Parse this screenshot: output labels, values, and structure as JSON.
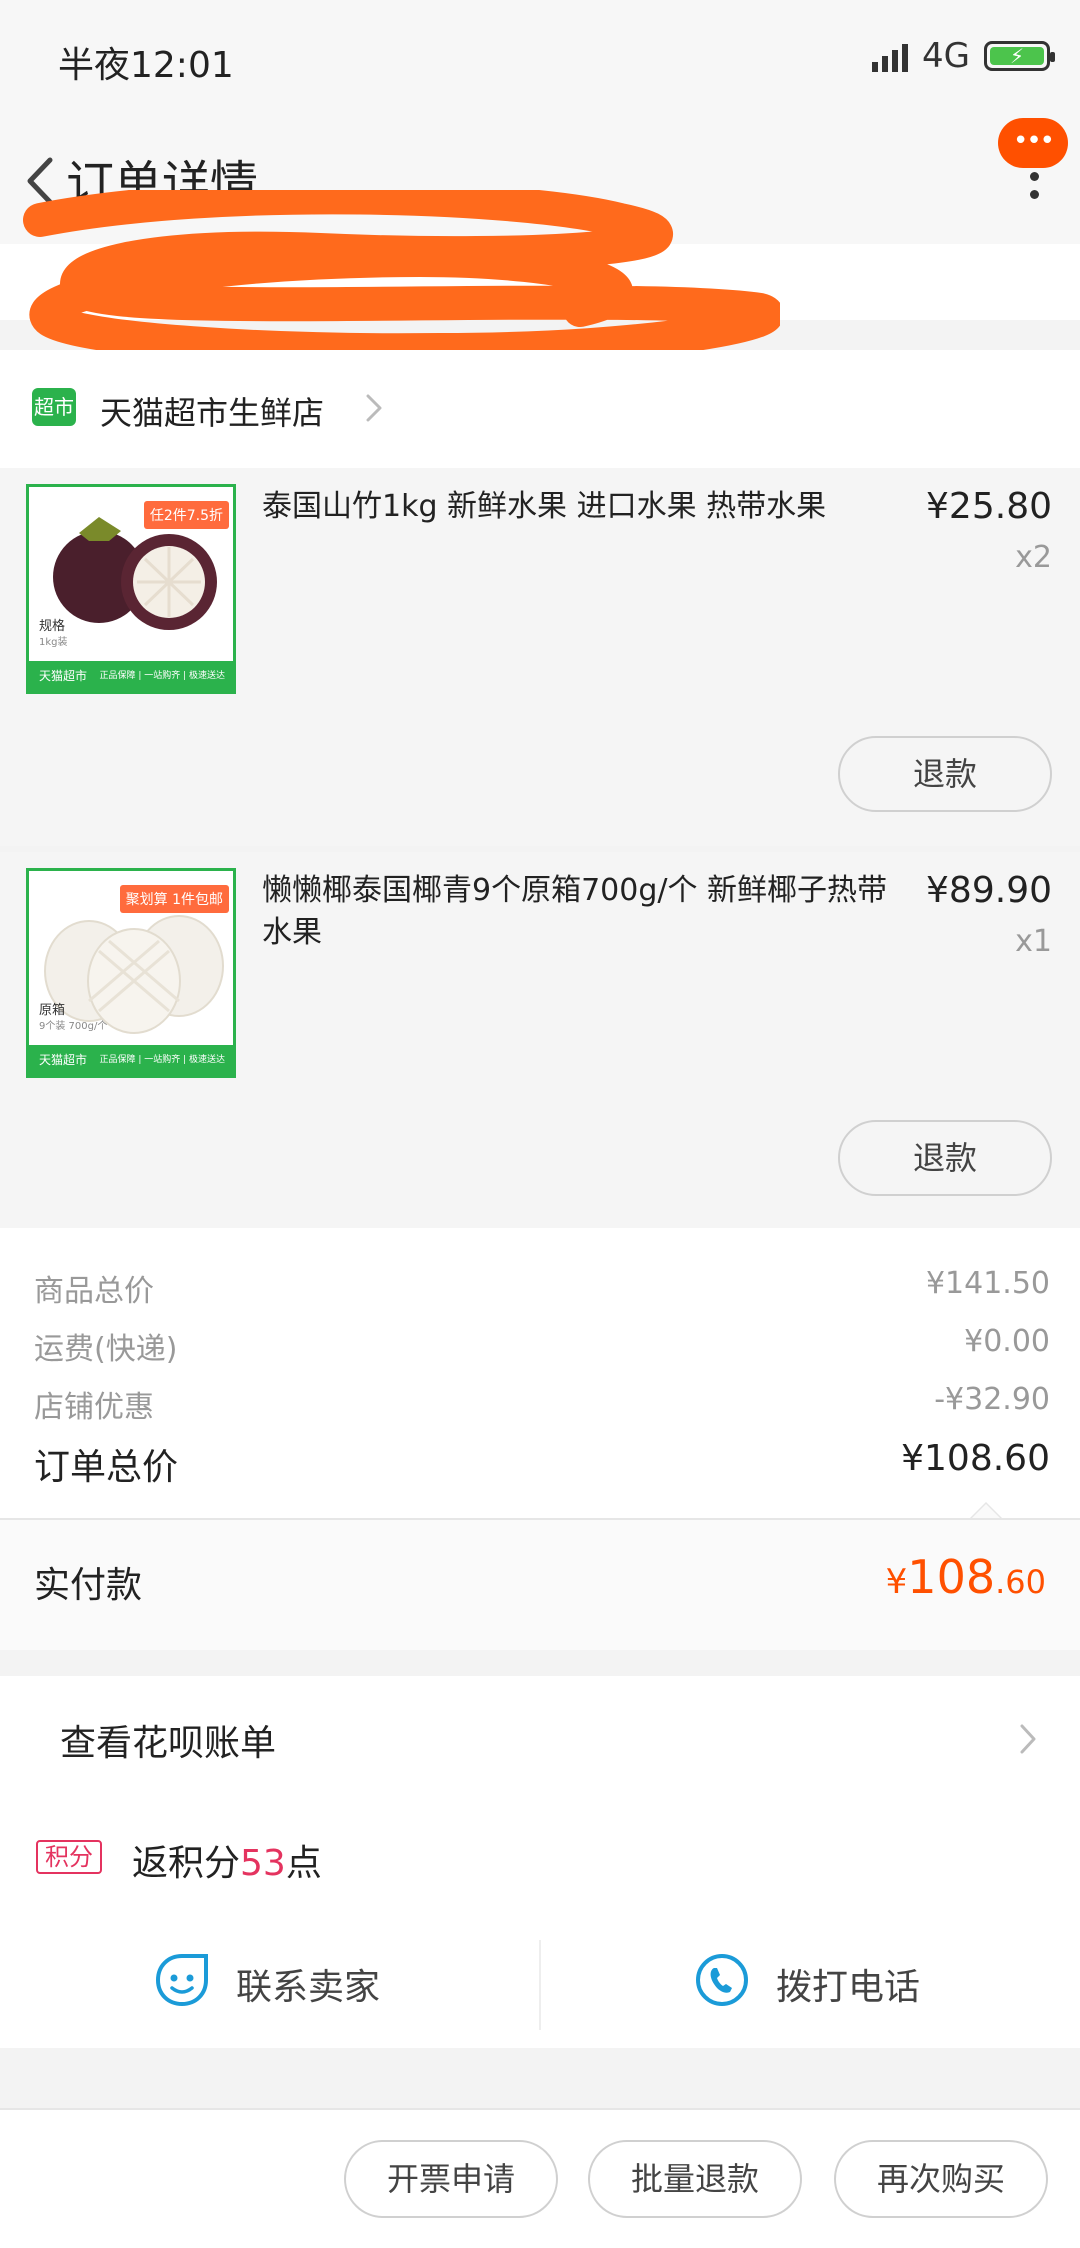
{
  "status_bar": {
    "time": "半夜12:01",
    "network": "4G"
  },
  "header": {
    "title": "订单详情",
    "more_badge": "•••"
  },
  "store": {
    "icon_label": "超市",
    "name": "天猫超市生鲜店"
  },
  "items": [
    {
      "title": "泰国山竹1kg 新鲜水果 进口水果 热带水果",
      "price": "¥25.80",
      "qty": "x2",
      "thumb_tag": "任2件7.5折",
      "thumb_spec_label": "规格",
      "thumb_spec_value": "1kg装",
      "thumb_footer_left": "天猫超市",
      "thumb_footer_right": "正品保障 | 一站购齐 | 极速送达",
      "refund_label": "退款"
    },
    {
      "title": "懒懒椰泰国椰青9个原箱700g/个 新鲜椰子热带水果",
      "price": "¥89.90",
      "qty": "x1",
      "thumb_tag": "聚划算 1件包邮",
      "thumb_spec_label": "原箱",
      "thumb_spec_value": "9个装 700g/个",
      "thumb_footer_left": "天猫超市",
      "thumb_footer_right": "正品保障 | 一站购齐 | 极速送达",
      "refund_label": "退款"
    }
  ],
  "summary": {
    "goods_total_label": "商品总价",
    "goods_total": "¥141.50",
    "shipping_label": "运费(快递)",
    "shipping": "¥0.00",
    "discount_label": "店铺优惠",
    "discount": "-¥32.90",
    "order_total_label": "订单总价",
    "order_total": "¥108.60"
  },
  "paid": {
    "label": "实付款",
    "symbol": "¥",
    "integer": "108",
    "decimal": ".60"
  },
  "huabei": {
    "label": "查看花呗账单"
  },
  "points": {
    "tag": "积分",
    "prefix": "返积分",
    "value": "53",
    "suffix": "点"
  },
  "contact": {
    "seller_label": "联系卖家",
    "phone_label": "拨打电话"
  },
  "bottom_actions": {
    "invoice": "开票申请",
    "batch_refund": "批量退款",
    "rebuy": "再次购买"
  },
  "colors": {
    "accent": "#ff5000",
    "tmall_green": "#2bb24c",
    "points_red": "#e4335f",
    "icon_blue": "#1b9bd8",
    "scribble": "#ff6a1c"
  }
}
